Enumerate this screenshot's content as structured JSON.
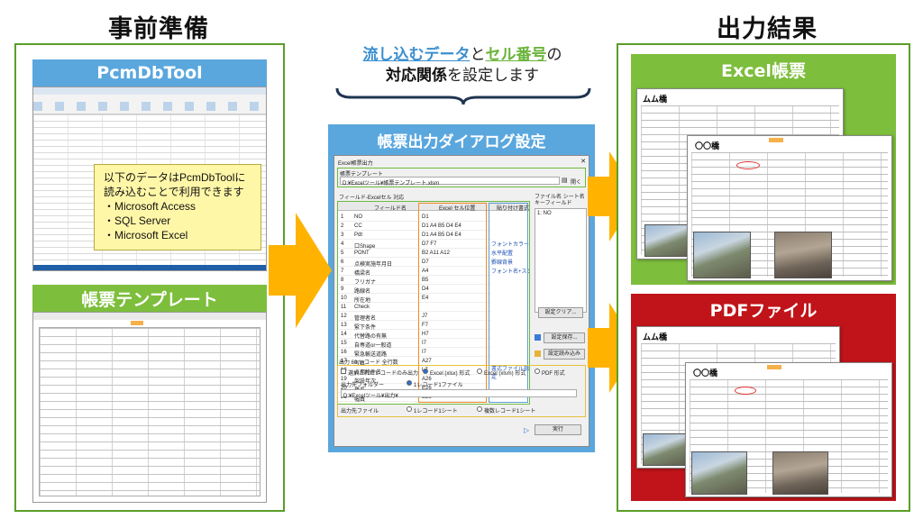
{
  "headings": {
    "prep": "事前準備",
    "output": "出力結果"
  },
  "center_caption": {
    "part1": "流し込むデータ",
    "part2": "と",
    "part3": "セル番号",
    "part4": "の",
    "line2a": "対応関係",
    "line2b": "を設定します"
  },
  "pcmdbtool": {
    "title": "PcmDbTool",
    "note_line1": "以下のデータはPcmDbToolに",
    "note_line2": "読み込むことで利用できます",
    "note_items": [
      "・Microsoft Access",
      "・SQL Server",
      "・Microsoft Excel"
    ]
  },
  "template": {
    "title": "帳票テンプレート"
  },
  "dialog_panel": {
    "title": "帳票出力ダイアログ設定",
    "window_title": "Excel帳票出力",
    "template_label": "帳票テンプレート",
    "template_value": "D:¥Excelツール¥帳票テンプレート.xlsm",
    "open_btn": "開く",
    "mapping_label": "フィールド-Excelセル 対応",
    "col_field": "フィールド名",
    "col_cell": "Excel セル位置",
    "col_format": "貼り付け書式",
    "col_right": "ファイル名 シート名 キーフィールド",
    "right_value": "1: NO",
    "rows": [
      {
        "no": "1",
        "field": "NO",
        "cell": "D1"
      },
      {
        "no": "2",
        "field": "CC",
        "cell": "D1 A4 B5 D4 E4"
      },
      {
        "no": "3",
        "field": "Pdt",
        "cell": "D1 A4 B5 D4 E4"
      },
      {
        "no": "4",
        "field": "口Shape",
        "cell": "D7 F7"
      },
      {
        "no": "5",
        "field": "PONT",
        "cell": "B2 A11 A12"
      },
      {
        "no": "6",
        "field": "点検実施年月日",
        "cell": "D7"
      },
      {
        "no": "7",
        "field": "橋梁名",
        "cell": "A4"
      },
      {
        "no": "8",
        "field": "フリガナ",
        "cell": "B5"
      },
      {
        "no": "9",
        "field": "路線名",
        "cell": "D4"
      },
      {
        "no": "10",
        "field": "所在地",
        "cell": "E4"
      },
      {
        "no": "11",
        "field": "Check",
        "cell": ""
      },
      {
        "no": "12",
        "field": "管理者名",
        "cell": "J7"
      },
      {
        "no": "13",
        "field": "緊下条件",
        "cell": "F7"
      },
      {
        "no": "14",
        "field": "代替路の有無",
        "cell": "H7"
      },
      {
        "no": "15",
        "field": "自専道or一般道",
        "cell": "I7"
      },
      {
        "no": "16",
        "field": "緊急輸送道路",
        "cell": "I7"
      },
      {
        "no": "17",
        "field": "写真",
        "cell": "A27"
      },
      {
        "no": "18",
        "field": "占用物件名",
        "cell": "L7"
      },
      {
        "no": "19",
        "field": "架設年次",
        "cell": "A26"
      },
      {
        "no": "20",
        "field": "橋長",
        "cell": "E26"
      },
      {
        "no": "21",
        "field": "幅員",
        "cell": "E28"
      }
    ],
    "format_items": [
      "フォントカラー",
      "水平配置",
      "罫線背景",
      "フォント名+スタイル"
    ],
    "format_extra": "書式ファイル指定",
    "btn_clear": "設定クリア...",
    "btn_save": "設定保存...",
    "btn_load": "設定読み込み",
    "output_label": "出力 60 レコード 全行数",
    "chk_selected": "選択されたレコードのみ出力",
    "radio_xlsx": "Excel (xlsx) 形式",
    "radio_xlsm": "Excel (xlsm) 形式",
    "radio_pdf": "PDF 形式",
    "out_folder_label": "出力先フォルダー",
    "one_record_file": "1レコード1ファイル",
    "out_folder_value": "D:¥Excelツール¥出力¥",
    "out_file_label": "出力先ファイル",
    "one_record_sheet": "1レコード1シート",
    "multi_record_sheet": "複数レコード1シート",
    "run_btn": "実行"
  },
  "excel_output": {
    "title": "Excel帳票",
    "bridge_name1": "ムム橋",
    "bridge_name2": "〇〇橋"
  },
  "pdf_output": {
    "title": "PDFファイル",
    "bridge_name1": "ムム橋",
    "bridge_name2": "〇〇橋"
  },
  "colors": {
    "green_banner": "#7dbe3c",
    "blue_banner": "#5aa7de",
    "red_banner": "#c0141a",
    "arrow": "#ffb300",
    "caption_blue": "#3a8fd0",
    "caption_green": "#69b43a"
  }
}
